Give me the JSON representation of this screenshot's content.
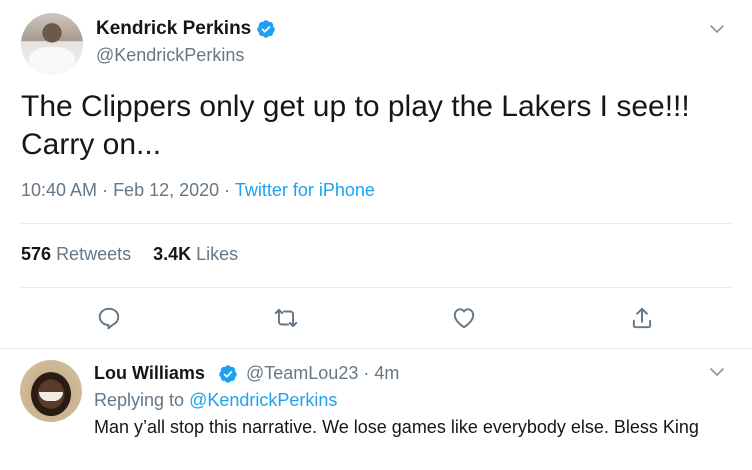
{
  "tweet": {
    "author_name": "Kendrick Perkins",
    "author_handle": "@KendrickPerkins",
    "text": "The Clippers only get up to play the Lakers I see!!! Carry on...",
    "time": "10:40 AM",
    "dot": " · ",
    "date": "Feb 12, 2020",
    "source": "Twitter for iPhone",
    "retweets_count": "576",
    "retweets_label": "Retweets",
    "likes_count": "3.4K",
    "likes_label": "Likes"
  },
  "reply": {
    "author_name": "Lou Williams",
    "author_handle": "@TeamLou23",
    "time_ago": "4m",
    "replying_to_label": "Replying to",
    "replying_to_handle": "@KendrickPerkins",
    "text": "Man y’all stop this narrative. We lose games like everybody else. Bless King"
  },
  "icons": {
    "verified": "verified-badge-icon",
    "chevron": "chevron-down-icon",
    "reply": "reply-icon",
    "retweet": "retweet-icon",
    "like": "heart-icon",
    "share": "share-icon"
  },
  "colors": {
    "accent": "#1da1f2",
    "text": "#14171a",
    "muted": "#657786",
    "divider": "#e6ecf0"
  }
}
